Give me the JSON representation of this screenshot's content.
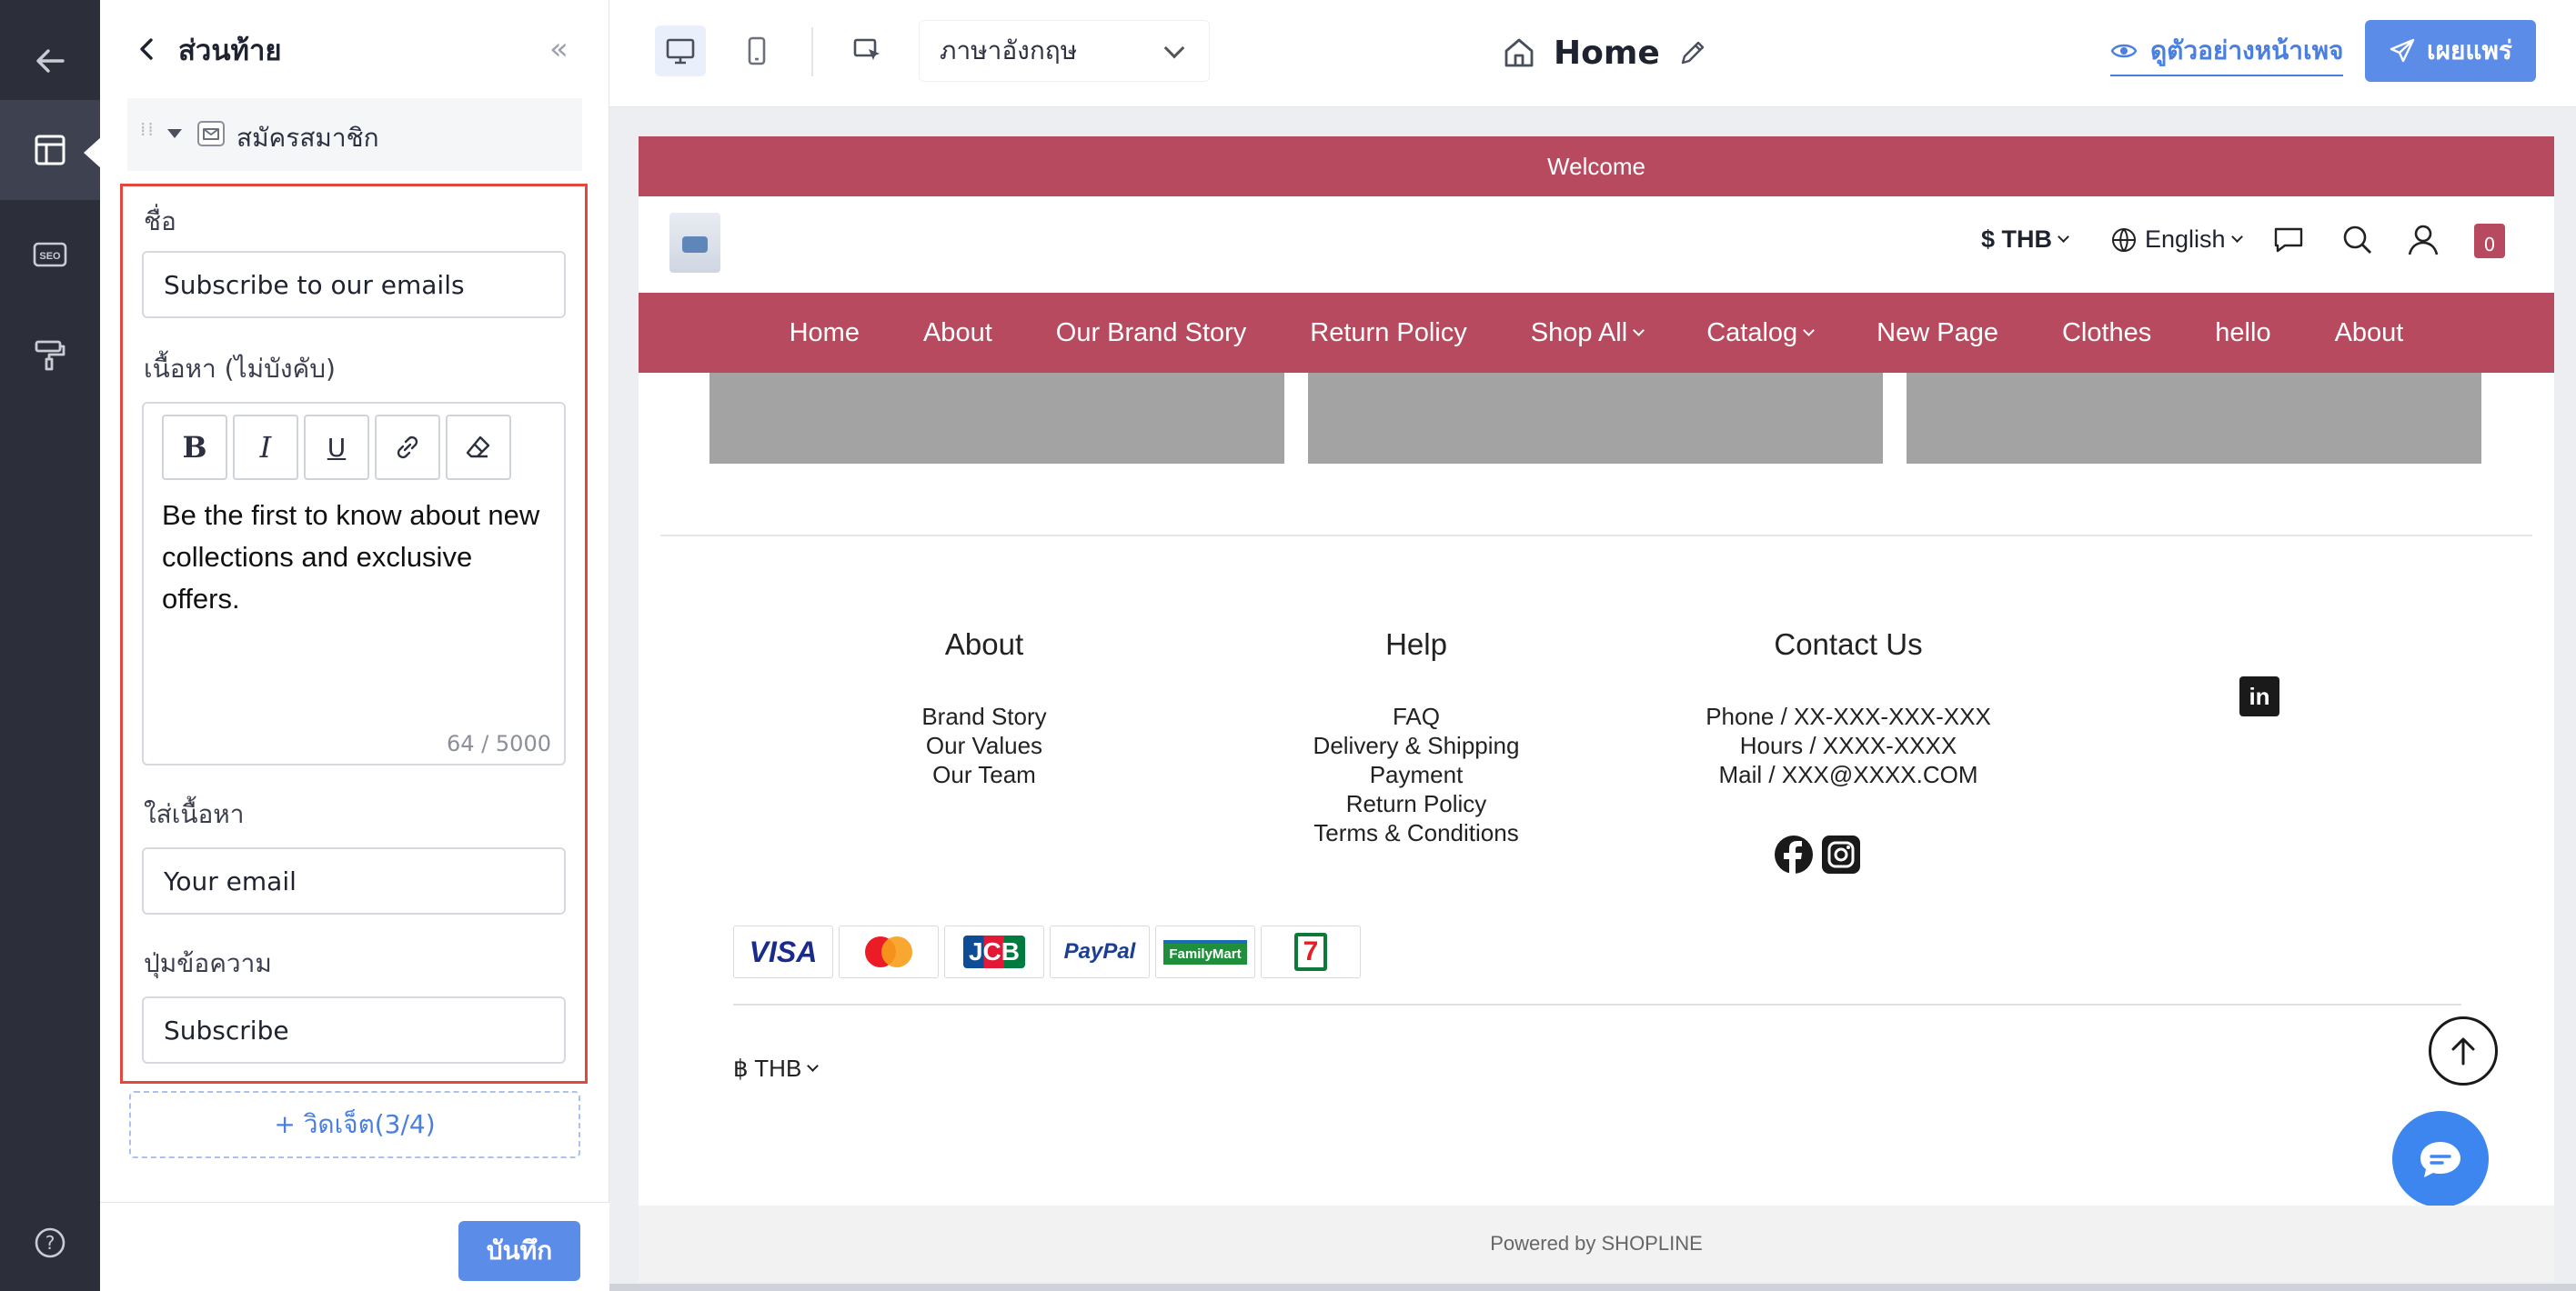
{
  "rail": {
    "items": [
      {
        "icon": "back-arrow-icon"
      },
      {
        "icon": "layout-icon",
        "active": true
      },
      {
        "icon": "seo-icon",
        "text": "SEO"
      },
      {
        "icon": "paint-roller-icon"
      },
      {
        "icon": "help-icon",
        "text": "?"
      }
    ]
  },
  "panel": {
    "title": "ส่วนท้าย",
    "collapse_glyph": "«",
    "tree_item": "สมัครสมาชิก",
    "fields": {
      "name_label": "ชื่อ",
      "name_value": "Subscribe to our emails",
      "content_label": "เนื้อหา (ไม่บังคับ)",
      "content_value": "Be the first to know about new collections and exclusive offers.",
      "char_count": "64 / 5000",
      "placeholder_label": "ใส่เนื้อหา",
      "placeholder_value": "Your email",
      "button_label": "ปุ่มข้อความ",
      "button_value": "Subscribe"
    },
    "toolbar": {
      "bold": "B",
      "italic": "I",
      "underline": "U"
    },
    "add_widget": "+ วิดเจ็ต(3/4)",
    "save": "บันทึก"
  },
  "topbar": {
    "language": "ภาษาอังกฤษ",
    "page_name": "Home",
    "preview": "ดูตัวอย่างหน้าเพจ",
    "publish": "เผยแพร่",
    "accent": "#5b8de8"
  },
  "site": {
    "announcement": "Welcome",
    "brand_color": "#b84a60",
    "header": {
      "currency": "$ THB",
      "language": "English",
      "cart_count": "0"
    },
    "nav": [
      {
        "label": "Home"
      },
      {
        "label": "About"
      },
      {
        "label": "Our Brand Story"
      },
      {
        "label": "Return Policy"
      },
      {
        "label": "Shop All",
        "dropdown": true
      },
      {
        "label": "Catalog",
        "dropdown": true
      },
      {
        "label": "New Page"
      },
      {
        "label": "Clothes"
      },
      {
        "label": "hello"
      },
      {
        "label": "About"
      }
    ],
    "footer": {
      "about": {
        "title": "About",
        "links": [
          "Brand Story",
          "Our Values",
          "Our Team"
        ]
      },
      "help": {
        "title": "Help",
        "links": [
          "FAQ",
          "Delivery & Shipping",
          "Payment",
          "Return Policy",
          "Terms & Conditions"
        ]
      },
      "contact": {
        "title": "Contact Us",
        "lines": [
          "Phone / XX-XXX-XXX-XXX",
          "Hours / XXXX-XXXX",
          "Mail / XXX@XXXX.COM"
        ]
      },
      "linkedin": "in"
    },
    "payments": {
      "visa": "VISA",
      "jcb": "JCB",
      "paypal": "PayPal",
      "familymart": "FamilyMart",
      "seven": "7"
    },
    "footer_currency": "฿ THB",
    "powered_by": "Powered by SHOPLINE"
  }
}
